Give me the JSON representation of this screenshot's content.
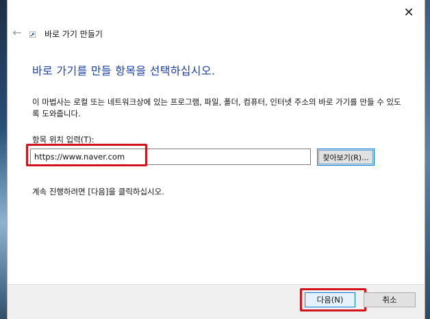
{
  "window": {
    "close_glyph": "✕",
    "back_glyph": "←",
    "wizard_title": "바로 가기 만들기"
  },
  "main": {
    "heading": "바로 가기를 만들 항목을 선택하십시오.",
    "description": "이 마법사는 로컬 또는 네트워크상에 있는 프로그램, 파일, 폴더, 컴퓨터, 인터넷 주소의 바로 가기를 만들 수 있도록 도와줍니다.",
    "location_label": "항목 위치 입력(T):",
    "location_value": "https://www.naver.com",
    "browse_label": "찾아보기(R)...",
    "continue_text": "계속 진행하려면 [다음]을 클릭하십시오."
  },
  "footer": {
    "next_label": "다음(N)",
    "cancel_label": "취소"
  },
  "colors": {
    "heading": "#1c3fa6",
    "highlight": "#d2141a",
    "focus_border": "#0078d7"
  },
  "icons": {
    "back": "back-arrow-icon",
    "close": "close-icon",
    "shortcut": "shortcut-icon"
  }
}
